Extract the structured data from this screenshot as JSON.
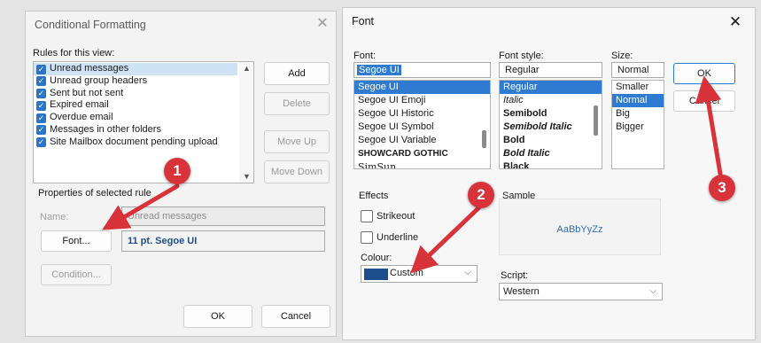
{
  "cf": {
    "title": "Conditional Formatting",
    "rules_label": "Rules for this view:",
    "rules": [
      "Unread messages",
      "Unread group headers",
      "Sent but not sent",
      "Expired email",
      "Overdue email",
      "Messages in other folders",
      "Site Mailbox document pending upload"
    ],
    "add": "Add",
    "delete": "Delete",
    "move_up": "Move Up",
    "move_down": "Move Down",
    "properties_label": "Properties of selected rule",
    "name_label": "Name:",
    "name_value": "Unread messages",
    "font_button": "Font...",
    "font_value": "11 pt. Segoe UI",
    "condition_button": "Condition...",
    "ok": "OK",
    "cancel": "Cancel"
  },
  "font": {
    "title": "Font",
    "font_label": "Font:",
    "font_value": "Segoe UI",
    "fonts": [
      "Segoe UI",
      "Segoe UI Emoji",
      "Segoe UI Historic",
      "Segoe UI Symbol",
      "Segoe UI Variable",
      "SHOWCARD GOTHIC",
      "SimSun"
    ],
    "style_label": "Font style:",
    "style_value": "Regular",
    "styles": [
      "Regular",
      "Italic",
      "Semibold",
      "Semibold Italic",
      "Bold",
      "Bold Italic",
      "Black"
    ],
    "size_label": "Size:",
    "size_value": "Normal",
    "sizes": [
      "Smaller",
      "Normal",
      "Big",
      "Bigger"
    ],
    "ok": "OK",
    "cancel": "Cancel",
    "effects_label": "Effects",
    "strikeout": "Strikeout",
    "underline": "Underline",
    "colour_label": "Colour:",
    "colour_value": "Custom",
    "colour_swatch": "#1f4e8c",
    "sample_label": "Sample",
    "sample_text": "AaBbYyZz",
    "script_label": "Script:",
    "script_value": "Western"
  },
  "badges": [
    "1",
    "2",
    "3"
  ],
  "colors": {
    "accent": "#2e7bd1",
    "badge": "#d8323a",
    "arrow": "#d8323a"
  }
}
